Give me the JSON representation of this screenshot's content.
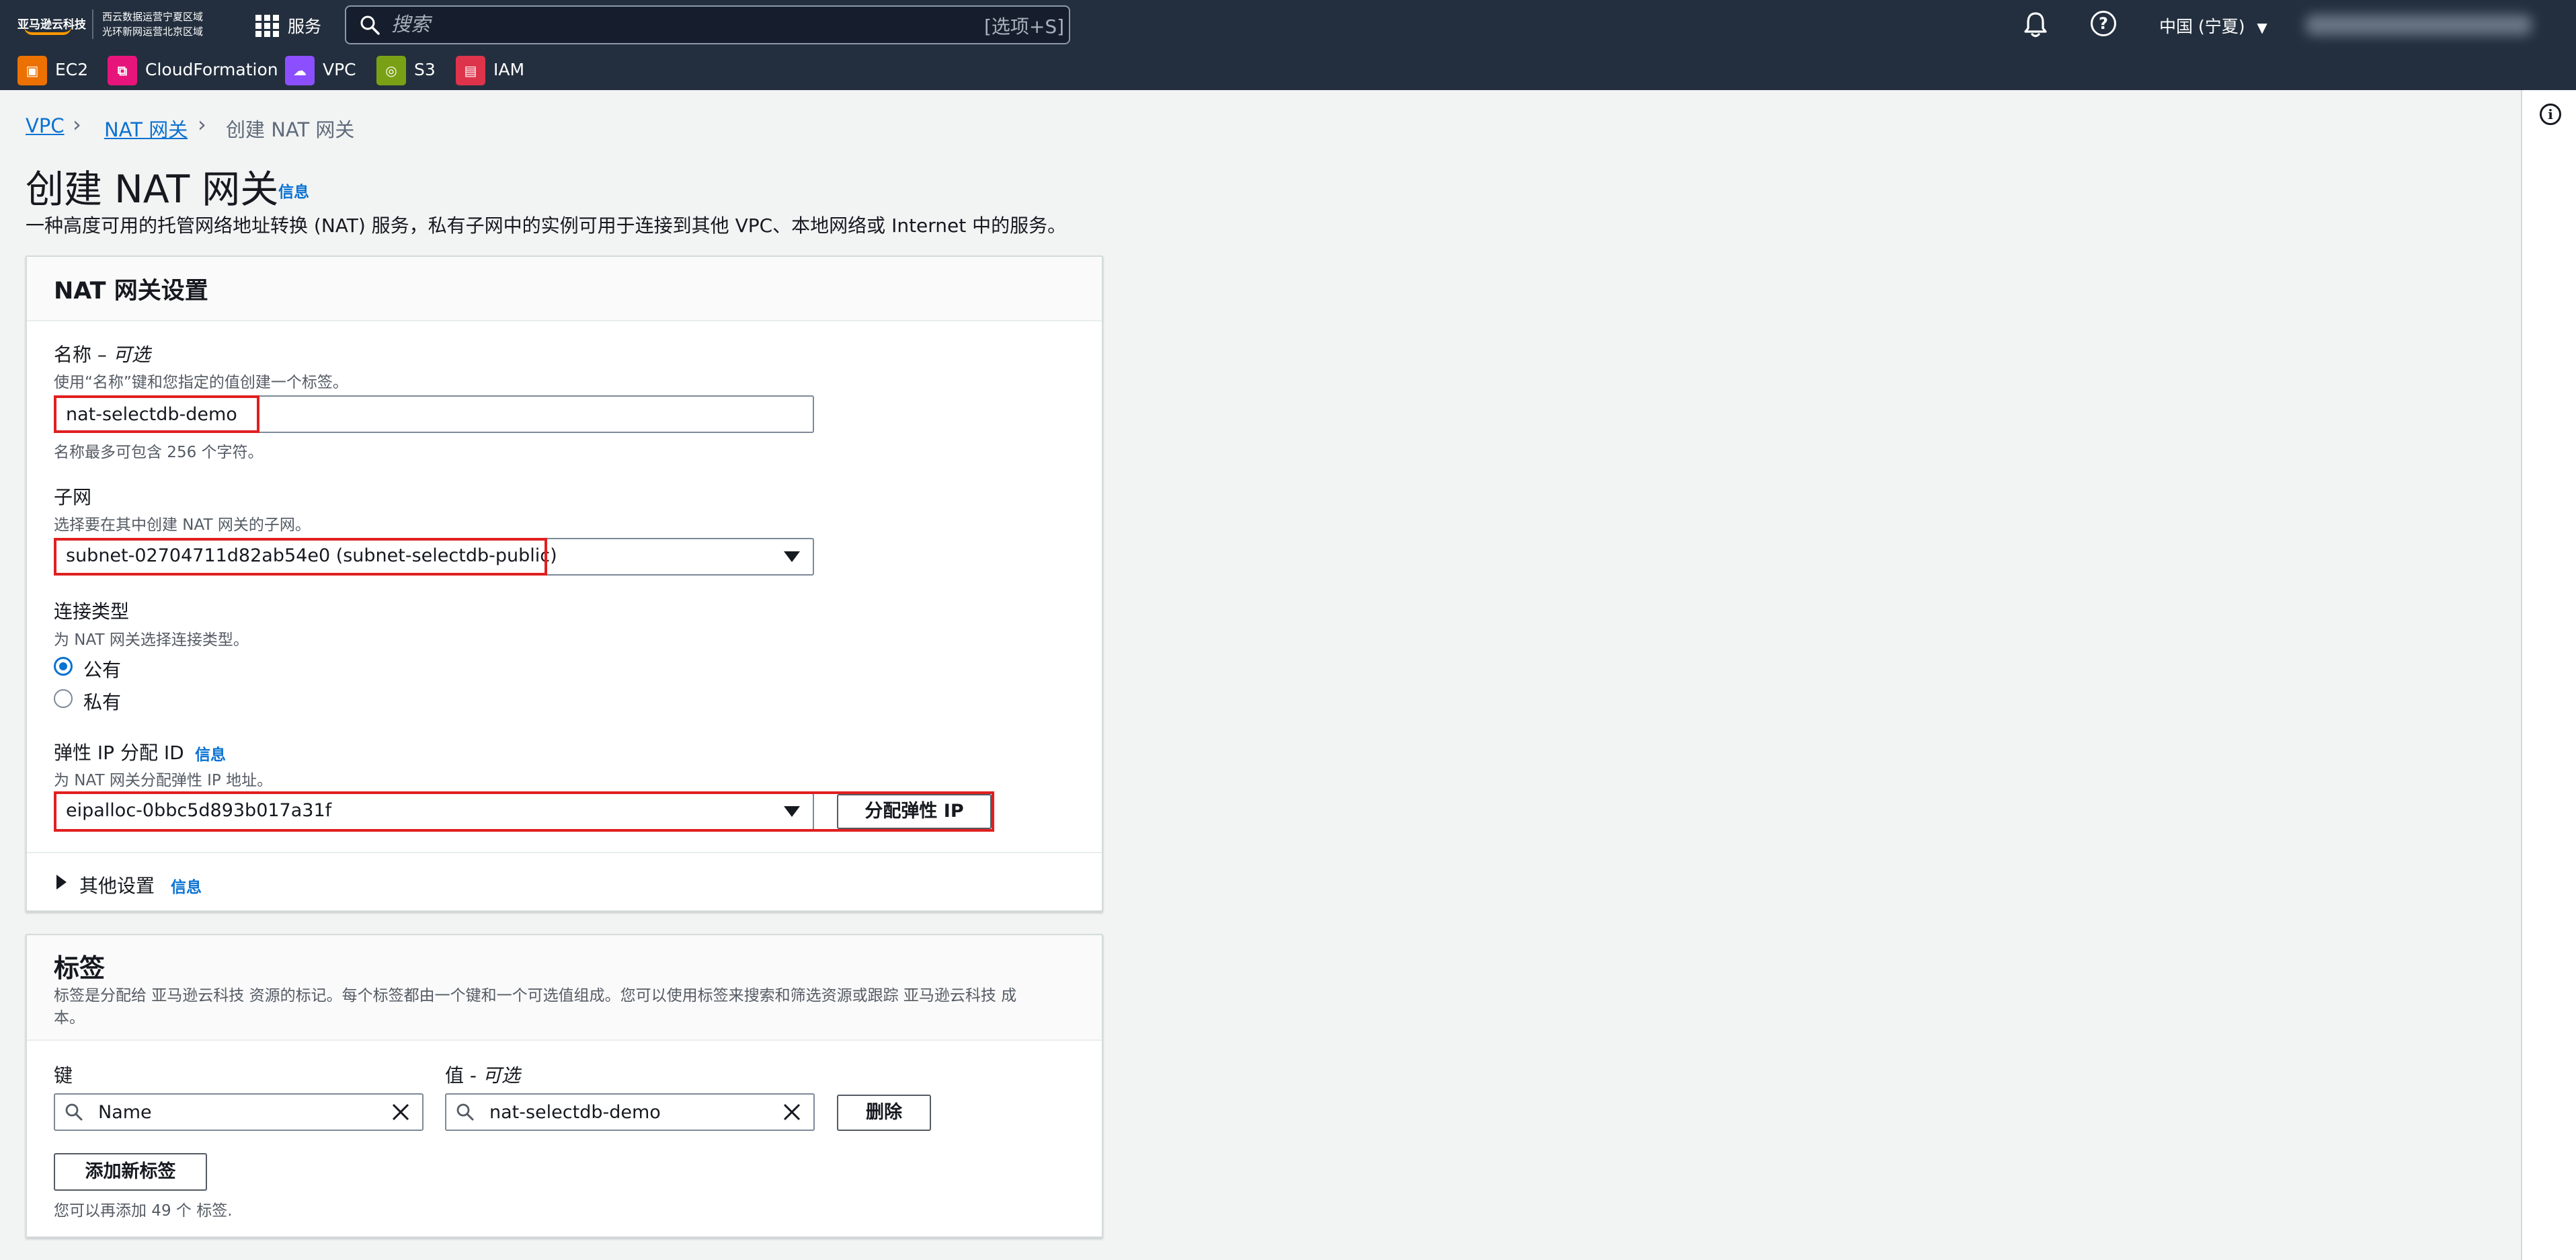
{
  "nav": {
    "logo": "亚马逊云科技",
    "logo_sub_line1": "西云数据运营宁夏区域",
    "logo_sub_line2": "光环新网运营北京区域",
    "services_label": "服务",
    "search_placeholder": "搜索",
    "search_shortcut": "[选项+S]",
    "region": "中国 (宁夏)",
    "account": "nanjidong @ 0045-8101-1348"
  },
  "favorites": [
    {
      "label": "EC2",
      "icon": "ec2-icon",
      "color": "#ed7100"
    },
    {
      "label": "CloudFormation",
      "icon": "cloudformation-icon",
      "color": "#e7157b"
    },
    {
      "label": "VPC",
      "icon": "vpc-icon",
      "color": "#8c4fff"
    },
    {
      "label": "S3",
      "icon": "s3-icon",
      "color": "#7aa116"
    },
    {
      "label": "IAM",
      "icon": "iam-icon",
      "color": "#dd344c"
    }
  ],
  "breadcrumb": {
    "item1": "VPC",
    "item2": "NAT 网关",
    "current": "创建 NAT 网关"
  },
  "header": {
    "title": "创建 NAT 网关",
    "info": "信息",
    "description": "一种高度可用的托管网络地址转换 (NAT) 服务，私有子网中的实例可用于连接到其他 VPC、本地网络或 Internet 中的服务。"
  },
  "settings": {
    "title": "NAT 网关设置",
    "name_label": "名称 – ",
    "name_optional": "可选",
    "name_desc": "使用“名称”键和您指定的值创建一个标签。",
    "name_value": "nat-selectdb-demo",
    "name_hint": "名称最多可包含 256 个字符。",
    "subnet_label": "子网",
    "subnet_desc": "选择要在其中创建 NAT 网关的子网。",
    "subnet_value": "subnet-02704711d82ab54e0 (subnet-selectdb-public)",
    "conn_label": "连接类型",
    "conn_desc": "为 NAT 网关选择连接类型。",
    "conn_options": [
      "公有",
      "私有"
    ],
    "conn_selected": "公有",
    "eip_label": "弹性 IP 分配 ID",
    "eip_info": "信息",
    "eip_desc": "为 NAT 网关分配弹性 IP 地址。",
    "eip_value": "eipalloc-0bbc5d893b017a31f",
    "eip_button": "分配弹性 IP",
    "other_label": "其他设置",
    "other_info": "信息"
  },
  "tags": {
    "title": "标签",
    "desc_line1": "标签是分配给 亚马逊云科技 资源的标记。每个标签都由一个键和一个可选值组成。您可以使用标签来搜索和筛选资源或跟踪 亚马逊云科技 成",
    "desc_line2": "本。",
    "key_label": "键",
    "value_label": "值 - ",
    "value_optional": "可选",
    "key_value": "Name",
    "value_value": "nat-selectdb-demo",
    "remove_button": "删除",
    "add_button": "添加新标签",
    "remaining": "您可以再添加 49 个 标签."
  },
  "colors": {
    "nav_bg": "#232f3e",
    "link": "#0972d3",
    "highlight": "#e02020",
    "page_bg": "#f2f3f3"
  }
}
